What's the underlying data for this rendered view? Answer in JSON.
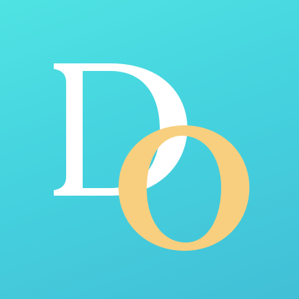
{
  "logo": {
    "letters": [
      "D",
      "O"
    ],
    "colors": {
      "background_top": "#4fe3e3",
      "background_bottom": "#42bfd6",
      "letter_d": "#ffffff",
      "letter_o": "#f8cf7f"
    }
  }
}
